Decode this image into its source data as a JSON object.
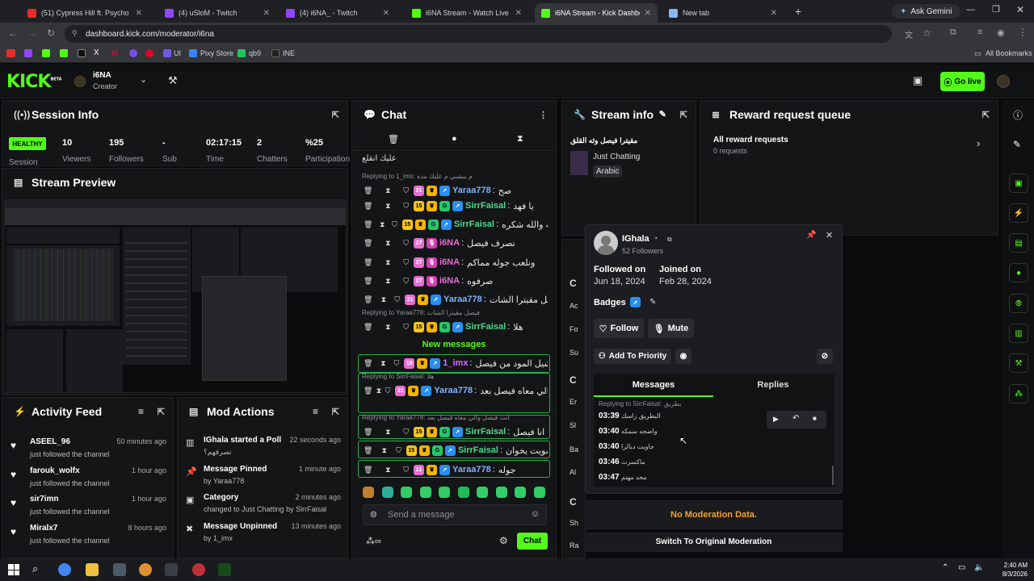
{
  "browser": {
    "tabs": [
      {
        "title": "(51) Cypress Hill ft. Psycho",
        "color": "#e52d27"
      },
      {
        "title": "(4) uSloM - Twitch",
        "color": "#9146ff"
      },
      {
        "title": "(4) i6NA_ - Twitch",
        "color": "#9146ff"
      },
      {
        "title": "i6NA Stream - Watch Live on Ki",
        "color": "#53fc18"
      },
      {
        "title": "i6NA Stream - Kick Dashboard",
        "color": "#53fc18"
      },
      {
        "title": "New tab",
        "color": "#8ab4f8"
      }
    ],
    "new_tab": "+",
    "ask_gemini": "Ask Gemini",
    "url": "dashboard.kick.com/moderator/i6na",
    "bookmarks": [
      "UI",
      "Pixy Store",
      "qb9",
      "INE"
    ],
    "all_bookmarks": "All Bookmarks"
  },
  "kick": {
    "logo": "KICK",
    "logo_sup": "BETA",
    "channel": "i6NA",
    "role": "Creator",
    "go_live": "Go live",
    "accent": "#53fc18"
  },
  "session": {
    "title": "Session Info",
    "status": "HEALTHY",
    "session_label": "Session",
    "stats": [
      {
        "value": "10",
        "label": "Viewers"
      },
      {
        "value": "195",
        "label": "Followers"
      },
      {
        "value": "-",
        "label": "Sub"
      },
      {
        "value": "02:17:15",
        "label": "Time"
      },
      {
        "value": "2",
        "label": "Chatters"
      },
      {
        "value": "%25",
        "label": "Participation"
      }
    ]
  },
  "preview": {
    "title": "Stream Preview"
  },
  "activity": {
    "title": "Activity Feed",
    "items": [
      {
        "name": "ASEEL_96",
        "text": "just followed the channel",
        "time": "50 minutes ago"
      },
      {
        "name": "farouk_wolfx",
        "text": "just followed the channel",
        "time": "1 hour ago"
      },
      {
        "name": "sir7imn",
        "text": "just followed the channel",
        "time": "1 hour ago"
      },
      {
        "name": "Miralx7",
        "text": "just followed the channel",
        "time": "8 hours ago"
      }
    ]
  },
  "mod_actions": {
    "title": "Mod Actions",
    "items": [
      {
        "icon": "poll-icon",
        "title": "IGhala started a Poll",
        "sub": "تصرفهم؟",
        "time": "22 seconds ago"
      },
      {
        "icon": "pin-icon",
        "title": "Message Pinned",
        "sub": "by Yaraa778",
        "time": "1 minute ago"
      },
      {
        "icon": "category-icon",
        "title": "Category",
        "sub": "changed to Just Chatting by SirrFaisal",
        "time": "2 minutes ago"
      },
      {
        "icon": "unpin-icon",
        "title": "Message Unpinned",
        "sub": "by 1_imx",
        "time": "13 minutes ago"
      }
    ]
  },
  "chat": {
    "title": "Chat",
    "top_text": "عليك انقلع",
    "messages": [
      {
        "reply": "Replying to 1_imx: م ينشبي م عليك مده",
        "user": "Yaraa778",
        "color": "#7fb3ff",
        "text": "صح",
        "badges": [
          "pink21",
          "crown",
          "blue"
        ]
      },
      {
        "user": "SirrFaisal",
        "color": "#4ed88a",
        "text": "يا فهد",
        "badges": [
          "num15",
          "crown",
          "grn",
          "blue"
        ]
      },
      {
        "user": "SirrFaisal",
        "color": "#4ed88a",
        "text": "جوله والله شكره",
        "badges": [
          "num15",
          "crown",
          "grn",
          "blue"
        ]
      },
      {
        "user": "i6NA",
        "color": "#e96cd4",
        "text": "نصرف فيصل",
        "badges": [
          "pink27",
          "mic"
        ]
      },
      {
        "user": "i6NA",
        "color": "#e96cd4",
        "text": "ونلعب جوله مماكم",
        "badges": [
          "pink27",
          "mic"
        ]
      },
      {
        "user": "i6NA",
        "color": "#e96cd4",
        "text": "صرفوه",
        "badges": [
          "pink27",
          "mic"
        ]
      },
      {
        "user": "Yaraa778",
        "color": "#7fb3ff",
        "text": "فيصل مقيترا الشات",
        "badges": [
          "pink21",
          "crown",
          "blue"
        ]
      },
      {
        "reply": "Replying to Yaraa778: فيصل مقيترا الشات",
        "user": "SirrFaisal",
        "color": "#4ed88a",
        "text": "هلا",
        "badges": [
          "num15",
          "crown",
          "grn",
          "blue"
        ]
      }
    ],
    "new_messages_label": "New messages",
    "new_messages": [
      {
        "user": "1_imx",
        "color": "#d46bff",
        "text": "فهد شيل المود من فيصل",
        "badges": [
          "pink19",
          "crown",
          "blue"
        ]
      },
      {
        "reply": "Replying to SirrFaisal: هلا",
        "user": "Yaraa778",
        "color": "#7fb3ff",
        "text": "انت فيصل والي معاه فيصل بعد",
        "badges": [
          "pink21",
          "crown",
          "blue"
        ]
      },
      {
        "reply": "Replying to Yaraa778: انت فيصل والي معاه فيصل بعد",
        "user": "SirrFaisal",
        "color": "#4ed88a",
        "text": "انا فيصل",
        "badges": [
          "num15",
          "crown",
          "grn",
          "blue"
        ]
      },
      {
        "user": "SirrFaisal",
        "color": "#4ed88a",
        "text": "تصويت يخوان",
        "badges": [
          "num15",
          "crown",
          "grn",
          "blue"
        ]
      },
      {
        "user": "Yaraa778",
        "color": "#7fb3ff",
        "text": "جوله",
        "badges": [
          "pink21",
          "crown",
          "blue"
        ]
      }
    ],
    "input_placeholder": "Send a message",
    "send_label": "Chat"
  },
  "stream_info": {
    "title": "Stream info",
    "stream_title": "مقيترا فيصل وثه القلق",
    "category": "Just Chatting",
    "language": "Arabic"
  },
  "rewards": {
    "title": "Reward request queue",
    "all_label": "All reward requests",
    "count": "0 requests"
  },
  "user_card": {
    "name": "IGhala",
    "followers": "52 Followers",
    "followed_label": "Followed on",
    "followed_date": "Jun 18, 2024",
    "joined_label": "Joined on",
    "joined_date": "Feb 28, 2024",
    "badges_label": "Badges",
    "follow_label": "Follow",
    "mute_label": "Mute",
    "priority_label": "Add To Priority",
    "tab_messages": "Messages",
    "tab_replies": "Replies",
    "reply_line": "Replying to SirrFaisal: بطريق",
    "messages": [
      {
        "time": "03:39",
        "text": "البطريق زاسك"
      },
      {
        "time": "03:40",
        "text": "واضحه سمكه"
      },
      {
        "time": "03:40",
        "text": "جاويت ديالرا"
      },
      {
        "time": "03:46",
        "text": "ماكسرت"
      },
      {
        "time": "03:47",
        "text": "محد مهتم"
      }
    ]
  },
  "moderation": {
    "no_data": "No Moderation Data.",
    "switch": "Switch To Original Moderation"
  },
  "hidden_panel_letters": [
    "C",
    "Ac",
    "Fo",
    "Su",
    "C",
    "Er",
    "Sl",
    "Ba",
    "Al",
    "C",
    "Sh",
    "Ra"
  ],
  "taskbar": {
    "time": "2:40 AM",
    "date": "8/3/2026"
  }
}
